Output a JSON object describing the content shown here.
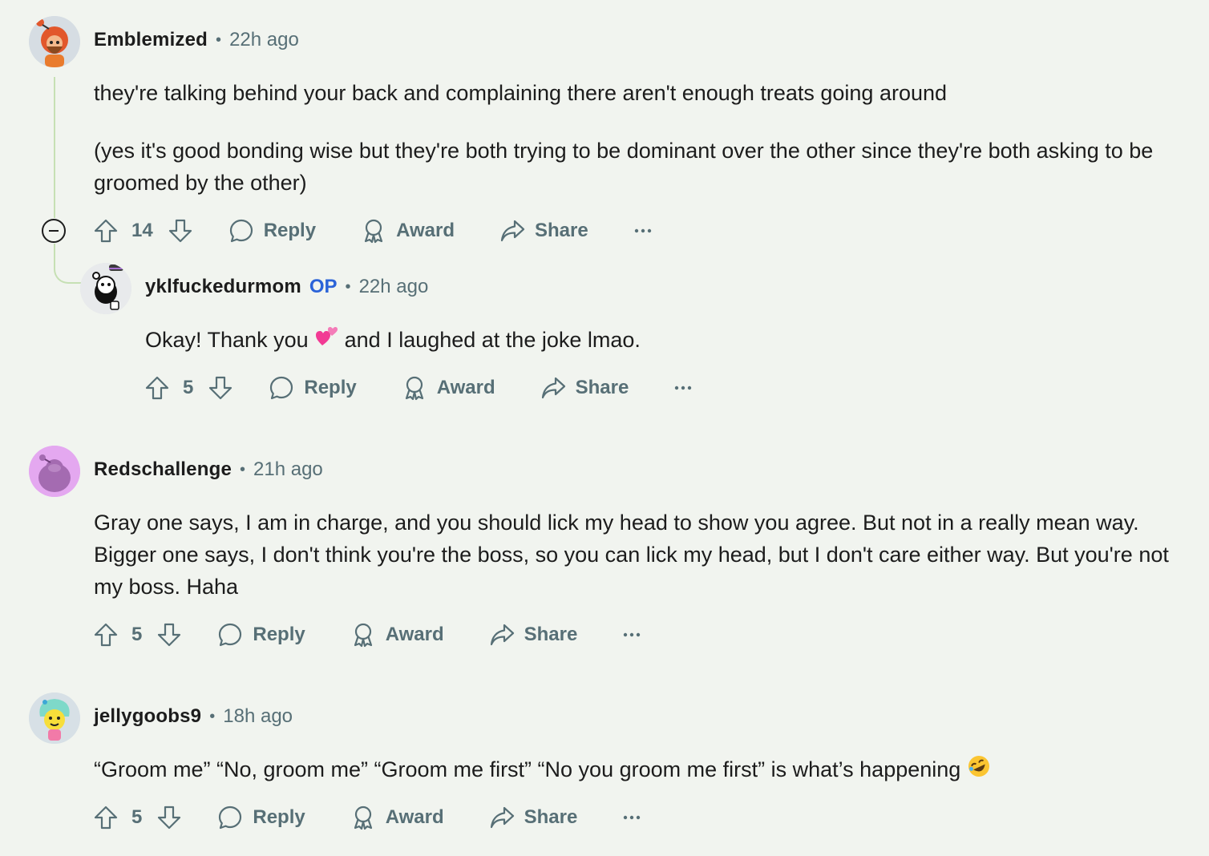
{
  "comments": [
    {
      "username": "Emblemized",
      "time": "22h ago",
      "paragraphs": [
        "they're talking behind your back and complaining there aren't enough treats going around",
        "(yes it's good bonding wise but they're both trying to be dominant over the other since they're both asking to be groomed by the other)"
      ],
      "votes": "14"
    },
    {
      "username": "yklfuckedurmom",
      "op_badge": "OP",
      "time": "22h ago",
      "text_before_emoji": "Okay! Thank you",
      "emoji": "💕",
      "text_after_emoji": "and I laughed at the joke lmao.",
      "votes": "5"
    },
    {
      "username": "Redschallenge",
      "time": "21h ago",
      "text": "Gray one says, I am in charge, and you should lick my head to show you agree. But not in a really mean way. Bigger one says, I don't think you're the boss, so you can lick my head, but I don't care either way. But you're not my boss. Haha",
      "votes": "5"
    },
    {
      "username": "jellygoobs9",
      "time": "18h ago",
      "text": "“Groom me” “No, groom me” “Groom me first” “No you groom me first” is what’s happening",
      "emoji": "🤣",
      "votes": "5"
    }
  ],
  "actions": {
    "reply": "Reply",
    "award": "Award",
    "share": "Share",
    "more": "···"
  },
  "icons": [
    "upvote-icon",
    "downvote-icon",
    "reply-icon",
    "award-icon",
    "share-icon",
    "more-icon",
    "collapse-icon"
  ],
  "colors": {
    "background": "#f1f4ef",
    "meta_text": "#576f76",
    "op_badge": "#2b63d8",
    "thread_line": "#c6e0b4"
  }
}
